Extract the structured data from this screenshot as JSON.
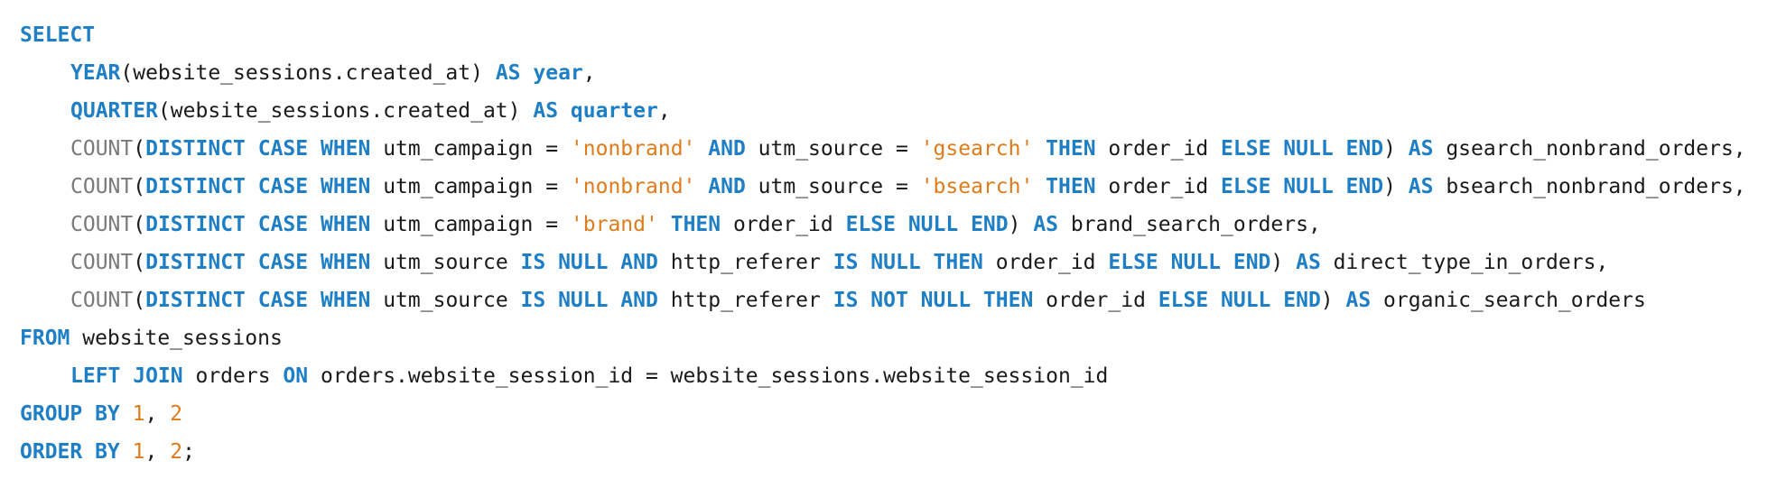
{
  "colors": {
    "keyword": "#1e7fc6",
    "function": "#7a7a7a",
    "string": "#e07b1a",
    "number": "#e07b1a",
    "identifier": "#1a1a1a",
    "background": "#ffffff"
  },
  "code": {
    "lines": [
      {
        "indent": 0,
        "tokens": [
          {
            "t": "kw",
            "v": "SELECT"
          }
        ]
      },
      {
        "indent": 1,
        "tokens": [
          {
            "t": "kw",
            "v": "YEAR"
          },
          {
            "t": "id",
            "v": "(website_sessions.created_at) "
          },
          {
            "t": "kw",
            "v": "AS"
          },
          {
            "t": "id",
            "v": " "
          },
          {
            "t": "kw",
            "v": "year"
          },
          {
            "t": "id",
            "v": ","
          }
        ]
      },
      {
        "indent": 1,
        "tokens": [
          {
            "t": "kw",
            "v": "QUARTER"
          },
          {
            "t": "id",
            "v": "(website_sessions.created_at) "
          },
          {
            "t": "kw",
            "v": "AS"
          },
          {
            "t": "id",
            "v": " "
          },
          {
            "t": "kw",
            "v": "quarter"
          },
          {
            "t": "id",
            "v": ","
          }
        ]
      },
      {
        "indent": 1,
        "tokens": [
          {
            "t": "fn",
            "v": "COUNT"
          },
          {
            "t": "id",
            "v": "("
          },
          {
            "t": "kw",
            "v": "DISTINCT CASE WHEN"
          },
          {
            "t": "id",
            "v": " utm_campaign = "
          },
          {
            "t": "str",
            "v": "'nonbrand'"
          },
          {
            "t": "id",
            "v": " "
          },
          {
            "t": "kw",
            "v": "AND"
          },
          {
            "t": "id",
            "v": " utm_source = "
          },
          {
            "t": "str",
            "v": "'gsearch'"
          },
          {
            "t": "id",
            "v": " "
          },
          {
            "t": "kw",
            "v": "THEN"
          },
          {
            "t": "id",
            "v": " order_id "
          },
          {
            "t": "kw",
            "v": "ELSE NULL END"
          },
          {
            "t": "id",
            "v": ") "
          },
          {
            "t": "kw",
            "v": "AS"
          },
          {
            "t": "id",
            "v": " gsearch_nonbrand_orders,"
          }
        ]
      },
      {
        "indent": 1,
        "tokens": [
          {
            "t": "fn",
            "v": "COUNT"
          },
          {
            "t": "id",
            "v": "("
          },
          {
            "t": "kw",
            "v": "DISTINCT CASE WHEN"
          },
          {
            "t": "id",
            "v": " utm_campaign = "
          },
          {
            "t": "str",
            "v": "'nonbrand'"
          },
          {
            "t": "id",
            "v": " "
          },
          {
            "t": "kw",
            "v": "AND"
          },
          {
            "t": "id",
            "v": " utm_source = "
          },
          {
            "t": "str",
            "v": "'bsearch'"
          },
          {
            "t": "id",
            "v": " "
          },
          {
            "t": "kw",
            "v": "THEN"
          },
          {
            "t": "id",
            "v": " order_id "
          },
          {
            "t": "kw",
            "v": "ELSE NULL END"
          },
          {
            "t": "id",
            "v": ") "
          },
          {
            "t": "kw",
            "v": "AS"
          },
          {
            "t": "id",
            "v": " bsearch_nonbrand_orders,"
          }
        ]
      },
      {
        "indent": 1,
        "tokens": [
          {
            "t": "fn",
            "v": "COUNT"
          },
          {
            "t": "id",
            "v": "("
          },
          {
            "t": "kw",
            "v": "DISTINCT CASE WHEN"
          },
          {
            "t": "id",
            "v": " utm_campaign = "
          },
          {
            "t": "str",
            "v": "'brand'"
          },
          {
            "t": "id",
            "v": " "
          },
          {
            "t": "kw",
            "v": "THEN"
          },
          {
            "t": "id",
            "v": " order_id "
          },
          {
            "t": "kw",
            "v": "ELSE NULL END"
          },
          {
            "t": "id",
            "v": ") "
          },
          {
            "t": "kw",
            "v": "AS"
          },
          {
            "t": "id",
            "v": " brand_search_orders,"
          }
        ]
      },
      {
        "indent": 1,
        "tokens": [
          {
            "t": "fn",
            "v": "COUNT"
          },
          {
            "t": "id",
            "v": "("
          },
          {
            "t": "kw",
            "v": "DISTINCT CASE WHEN"
          },
          {
            "t": "id",
            "v": " utm_source "
          },
          {
            "t": "kw",
            "v": "IS NULL AND"
          },
          {
            "t": "id",
            "v": " http_referer "
          },
          {
            "t": "kw",
            "v": "IS NULL THEN"
          },
          {
            "t": "id",
            "v": " order_id "
          },
          {
            "t": "kw",
            "v": "ELSE NULL END"
          },
          {
            "t": "id",
            "v": ") "
          },
          {
            "t": "kw",
            "v": "AS"
          },
          {
            "t": "id",
            "v": " direct_type_in_orders,"
          }
        ]
      },
      {
        "indent": 1,
        "tokens": [
          {
            "t": "fn",
            "v": "COUNT"
          },
          {
            "t": "id",
            "v": "("
          },
          {
            "t": "kw",
            "v": "DISTINCT CASE WHEN"
          },
          {
            "t": "id",
            "v": " utm_source "
          },
          {
            "t": "kw",
            "v": "IS NULL AND"
          },
          {
            "t": "id",
            "v": " http_referer "
          },
          {
            "t": "kw",
            "v": "IS NOT NULL THEN"
          },
          {
            "t": "id",
            "v": " order_id "
          },
          {
            "t": "kw",
            "v": "ELSE NULL END"
          },
          {
            "t": "id",
            "v": ") "
          },
          {
            "t": "kw",
            "v": "AS"
          },
          {
            "t": "id",
            "v": " organic_search_orders"
          }
        ]
      },
      {
        "indent": 0,
        "tokens": [
          {
            "t": "kw",
            "v": "FROM"
          },
          {
            "t": "id",
            "v": " website_sessions"
          }
        ]
      },
      {
        "indent": 1,
        "tokens": [
          {
            "t": "kw",
            "v": "LEFT JOIN"
          },
          {
            "t": "id",
            "v": " orders "
          },
          {
            "t": "kw",
            "v": "ON"
          },
          {
            "t": "id",
            "v": " orders.website_session_id = website_sessions.website_session_id"
          }
        ]
      },
      {
        "indent": 0,
        "tokens": [
          {
            "t": "kw",
            "v": "GROUP BY"
          },
          {
            "t": "id",
            "v": " "
          },
          {
            "t": "num",
            "v": "1"
          },
          {
            "t": "id",
            "v": ", "
          },
          {
            "t": "num",
            "v": "2"
          }
        ]
      },
      {
        "indent": 0,
        "tokens": [
          {
            "t": "kw",
            "v": "ORDER BY"
          },
          {
            "t": "id",
            "v": " "
          },
          {
            "t": "num",
            "v": "1"
          },
          {
            "t": "id",
            "v": ", "
          },
          {
            "t": "num",
            "v": "2"
          },
          {
            "t": "id",
            "v": ";"
          }
        ]
      }
    ]
  }
}
